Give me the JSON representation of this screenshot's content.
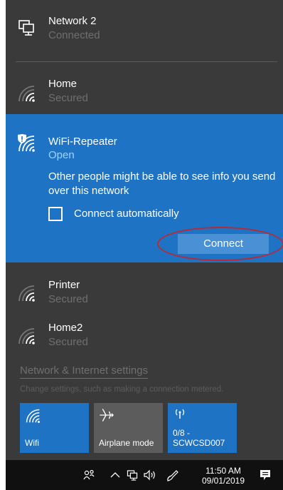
{
  "networks": [
    {
      "name": "Network 2",
      "status": "Connected",
      "icon": "ethernet-icon"
    },
    {
      "name": "Home",
      "status": "Secured",
      "icon": "wifi-signal-icon"
    },
    {
      "name": "WiFi-Repeater",
      "status": "Open",
      "icon": "wifi-shield-icon",
      "warning": "Other people might be able to see info you send over this network",
      "auto_connect_label": "Connect automatically",
      "auto_connect_checked": false,
      "connect_label": "Connect"
    },
    {
      "name": "Printer",
      "status": "Secured",
      "icon": "wifi-signal-icon"
    },
    {
      "name": "Home2",
      "status": "Secured",
      "icon": "wifi-signal-icon"
    }
  ],
  "settings": {
    "link": "Network & Internet settings",
    "description": "Change settings, such as making a connection metered."
  },
  "quick_actions": [
    {
      "label": "Wifi",
      "icon": "wifi-icon",
      "active": true
    },
    {
      "label": "Airplane mode",
      "icon": "airplane-icon",
      "active": false
    },
    {
      "label_line1": "0/8 -",
      "label_line2": "SCWCSD007",
      "icon": "hotspot-icon",
      "active": true
    }
  ],
  "taskbar": {
    "time": "11:50 AM",
    "date": "09/01/2019",
    "icons": [
      "people-icon",
      "chevron-up-icon",
      "network-icon",
      "volume-icon",
      "pen-icon",
      "notifications-icon"
    ]
  },
  "colors": {
    "panel_bg": "#3a3a3a",
    "accent": "#1f73c4",
    "taskbar_bg": "#101010",
    "annotation": "#b72a36"
  }
}
